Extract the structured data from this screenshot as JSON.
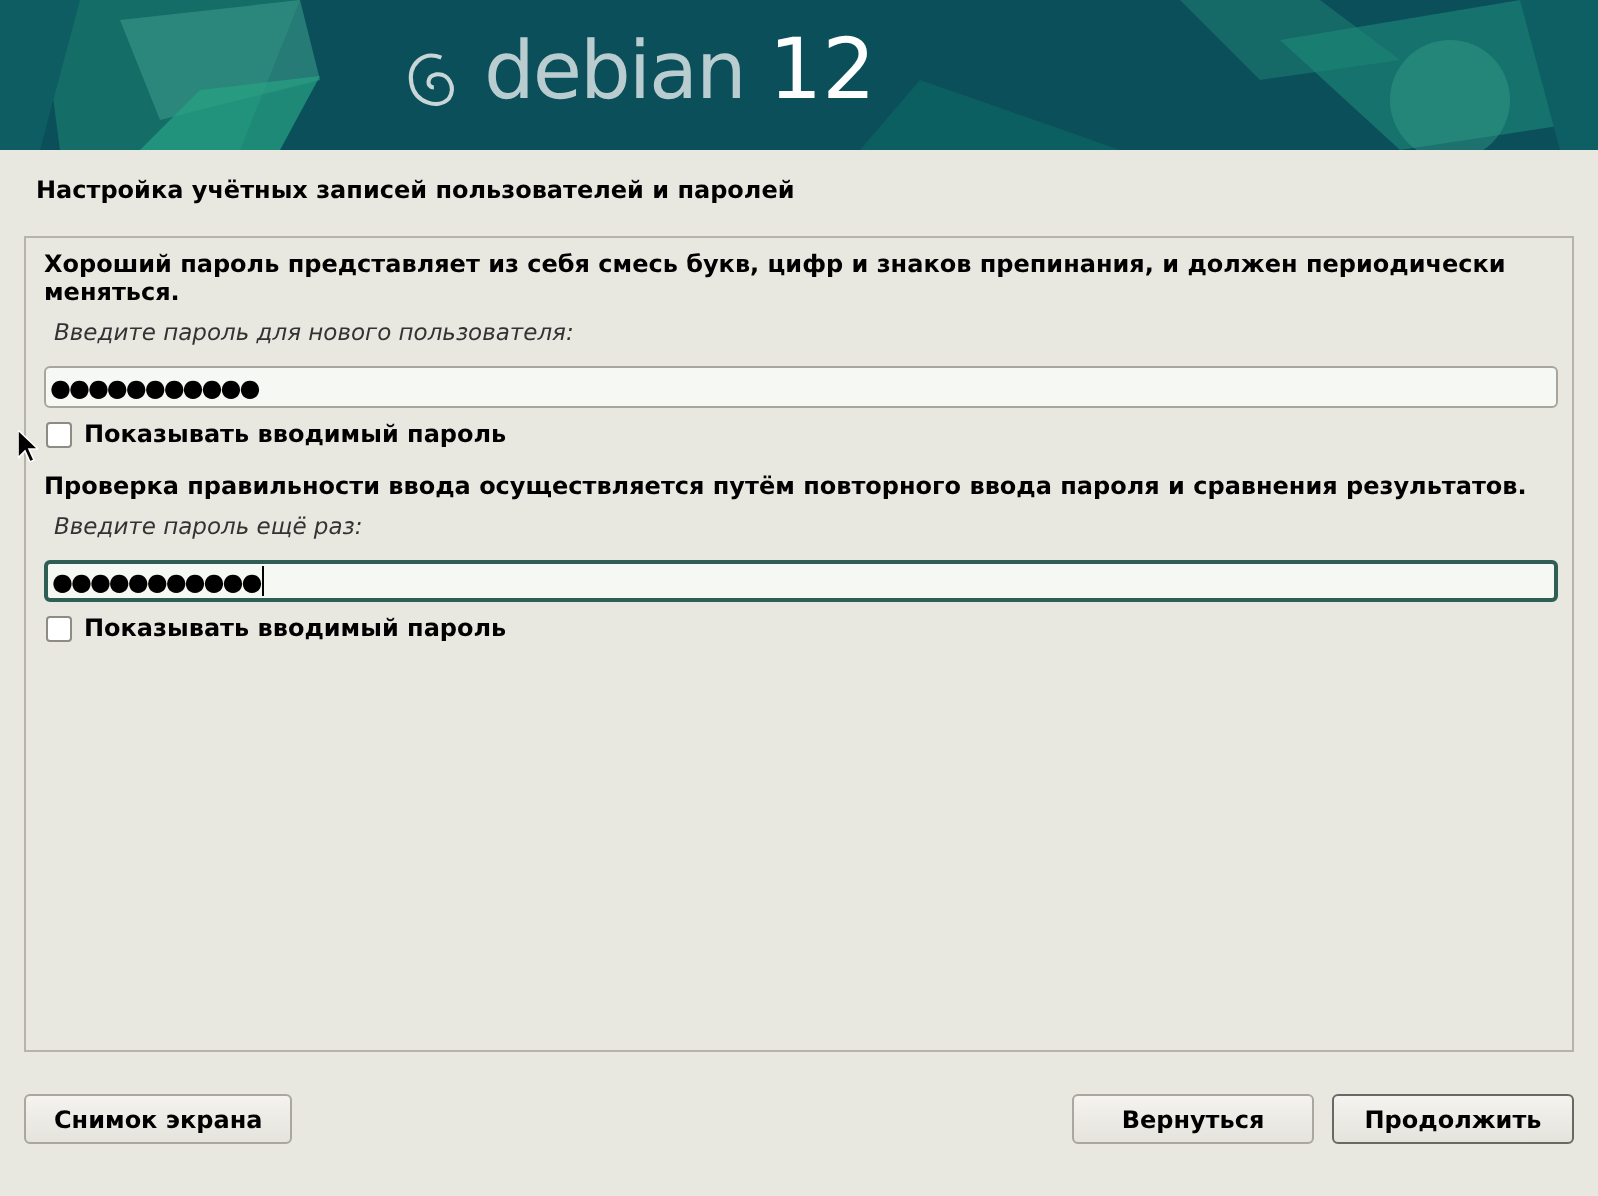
{
  "banner": {
    "logo_text": "debian",
    "version": "12"
  },
  "title": "Настройка учётных записей пользователей и паролей",
  "sections": [
    {
      "description": "Хороший пароль представляет из себя смесь букв, цифр и знаков препинания, и должен периодически меняться.",
      "prompt": "Введите пароль для нового пользователя:",
      "value": "●●●●●●●●●●●",
      "focused": false,
      "show_password": {
        "label": "Показывать вводимый пароль",
        "checked": false
      }
    },
    {
      "description": "Проверка правильности ввода осуществляется путём повторного ввода пароля и сравнения результатов.",
      "prompt": "Введите пароль ещё раз:",
      "value": "●●●●●●●●●●●",
      "focused": true,
      "show_password": {
        "label": "Показывать вводимый пароль",
        "checked": false
      }
    }
  ],
  "buttons": {
    "left": "Снимок экрана",
    "right": [
      "Вернуться",
      "Продолжить"
    ]
  }
}
